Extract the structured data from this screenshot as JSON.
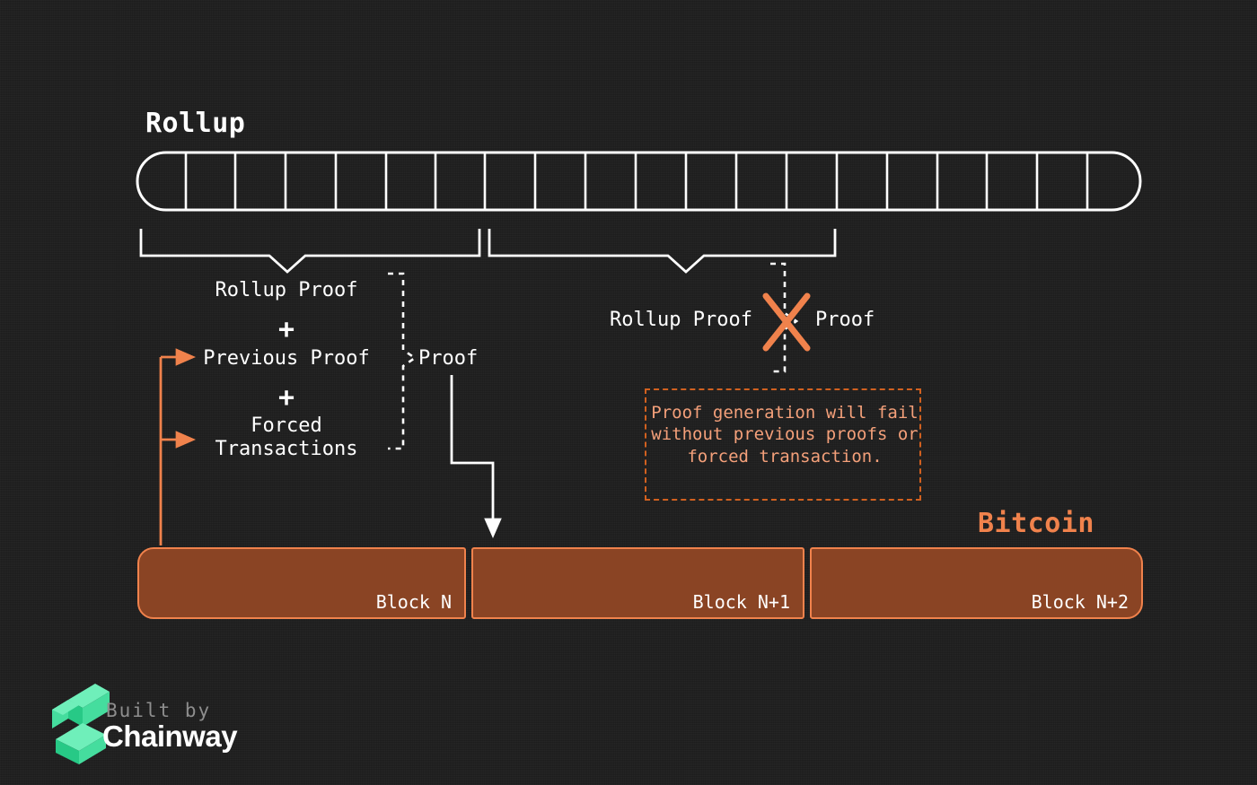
{
  "meta": {
    "colors": {
      "background": "#1d1d1d",
      "white": "#ffffff",
      "orange_accent": "#f0824c",
      "orange_dark": "#d1601f",
      "orange_text": "#f4a07a",
      "block_fill": "#8a4424",
      "logo_green": "#3ddc97",
      "muted_grey": "#8e8e8e"
    }
  },
  "rollup": {
    "title": "Rollup",
    "cell_count": 20
  },
  "left_group": {
    "formula": {
      "line1": "Rollup Proof",
      "plus1": "+",
      "line2": "Previous Proof",
      "plus2": "+",
      "line3": "Forced\nTransactions"
    },
    "result_label": "Proof"
  },
  "right_group": {
    "source_label": "Rollup Proof",
    "result_label": "Proof",
    "cross_icon": "x-mark-icon"
  },
  "warning": {
    "text": "Proof generation will\nfail without previous\nproofs or forced\ntransaction."
  },
  "bitcoin": {
    "title": "Bitcoin",
    "blocks": [
      {
        "label": "Block N"
      },
      {
        "label": "Block N+1"
      },
      {
        "label": "Block N+2"
      }
    ]
  },
  "footer": {
    "built_by": "Built by",
    "brand": "Chainway",
    "logo_icon": "chainway-logo-icon"
  }
}
